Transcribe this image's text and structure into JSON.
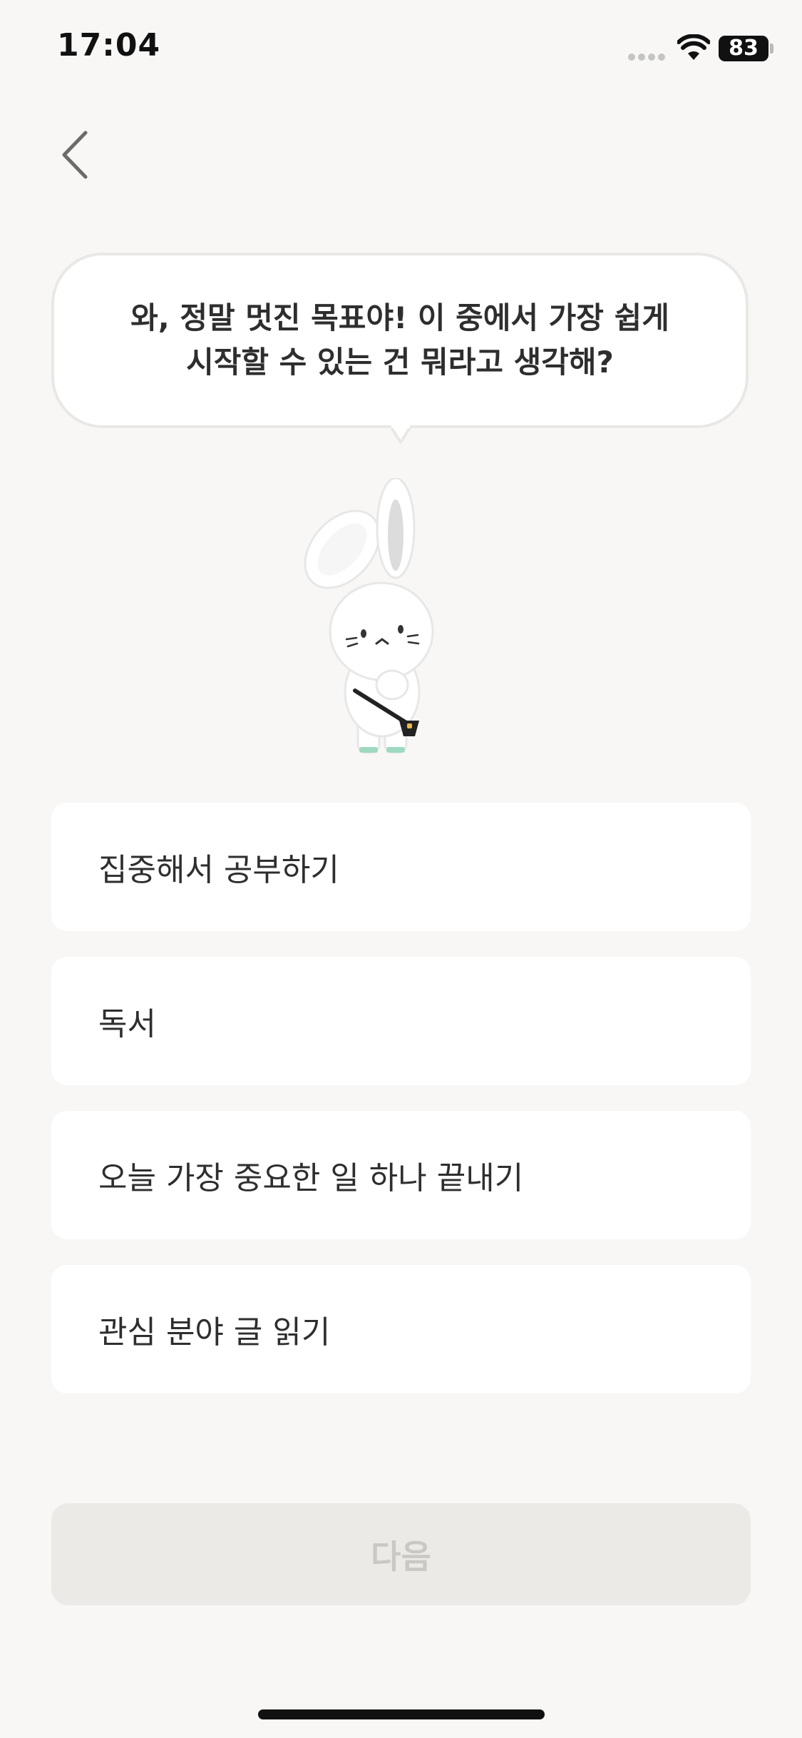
{
  "status_bar": {
    "time": "17:04",
    "battery": "83"
  },
  "speech": {
    "text": "와, 정말 멋진 목표야! 이 중에서 가장 쉽게\n시작할 수 있는 건 뭐라고 생각해?"
  },
  "mascot": {
    "icon": "rabbit-mascot"
  },
  "options": [
    {
      "label": "집중해서 공부하기"
    },
    {
      "label": "독서"
    },
    {
      "label": "오늘 가장 중요한 일 하나 끝내기"
    },
    {
      "label": "관심 분야 글 읽기"
    }
  ],
  "next_button": {
    "label": "다음",
    "state": "disabled"
  },
  "colors": {
    "background": "#f8f7f5",
    "card": "#ffffff",
    "button_disabled_bg": "#ebeae7",
    "button_disabled_text": "#c9c8c5"
  }
}
